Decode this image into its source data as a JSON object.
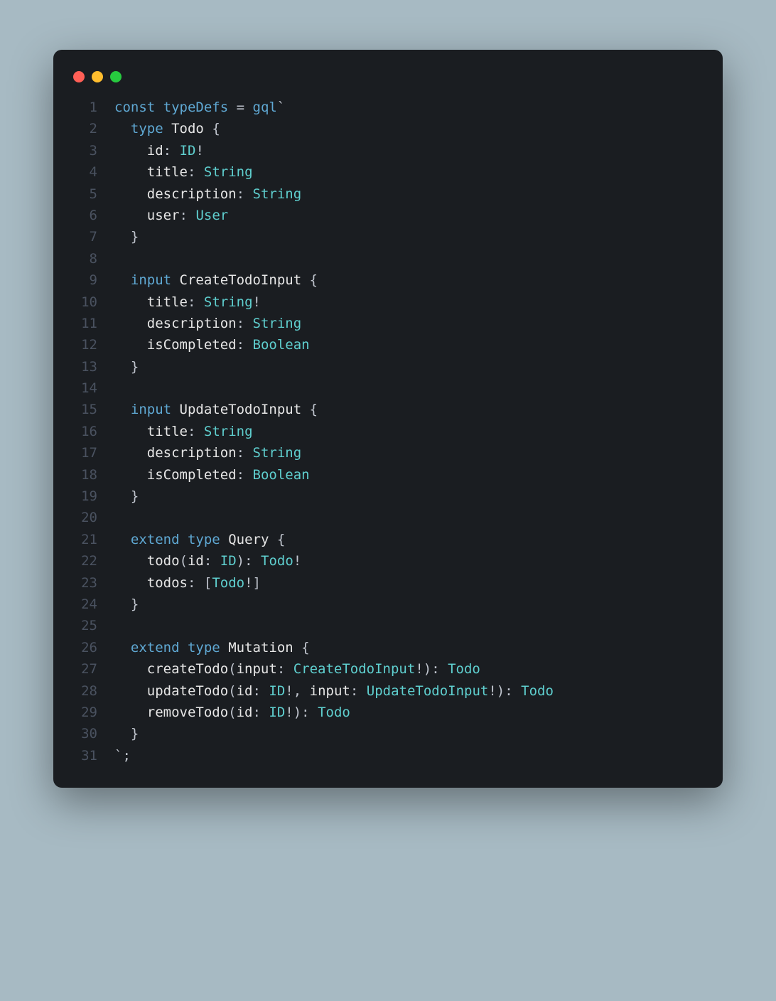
{
  "code": {
    "lines": [
      {
        "n": "1",
        "tokens": [
          [
            "kw",
            "const"
          ],
          [
            "plain",
            " "
          ],
          [
            "fn",
            "typeDefs"
          ],
          [
            "plain",
            " "
          ],
          [
            "op",
            "="
          ],
          [
            "plain",
            " "
          ],
          [
            "fn",
            "gql"
          ],
          [
            "punct",
            "`"
          ]
        ]
      },
      {
        "n": "2",
        "tokens": [
          [
            "plain",
            "  "
          ],
          [
            "kw",
            "type"
          ],
          [
            "plain",
            " "
          ],
          [
            "typename",
            "Todo"
          ],
          [
            "plain",
            " "
          ],
          [
            "punct",
            "{"
          ]
        ]
      },
      {
        "n": "3",
        "tokens": [
          [
            "plain",
            "    "
          ],
          [
            "field",
            "id"
          ],
          [
            "punct",
            ":"
          ],
          [
            "plain",
            " "
          ],
          [
            "ty",
            "ID"
          ],
          [
            "punct",
            "!"
          ]
        ]
      },
      {
        "n": "4",
        "tokens": [
          [
            "plain",
            "    "
          ],
          [
            "field",
            "title"
          ],
          [
            "punct",
            ":"
          ],
          [
            "plain",
            " "
          ],
          [
            "ty",
            "String"
          ]
        ]
      },
      {
        "n": "5",
        "tokens": [
          [
            "plain",
            "    "
          ],
          [
            "field",
            "description"
          ],
          [
            "punct",
            ":"
          ],
          [
            "plain",
            " "
          ],
          [
            "ty",
            "String"
          ]
        ]
      },
      {
        "n": "6",
        "tokens": [
          [
            "plain",
            "    "
          ],
          [
            "field",
            "user"
          ],
          [
            "punct",
            ":"
          ],
          [
            "plain",
            " "
          ],
          [
            "ty",
            "User"
          ]
        ]
      },
      {
        "n": "7",
        "tokens": [
          [
            "plain",
            "  "
          ],
          [
            "punct",
            "}"
          ]
        ]
      },
      {
        "n": "8",
        "tokens": [
          [
            "plain",
            ""
          ]
        ]
      },
      {
        "n": "9",
        "tokens": [
          [
            "plain",
            "  "
          ],
          [
            "kw",
            "input"
          ],
          [
            "plain",
            " "
          ],
          [
            "typename",
            "CreateTodoInput"
          ],
          [
            "plain",
            " "
          ],
          [
            "punct",
            "{"
          ]
        ]
      },
      {
        "n": "10",
        "tokens": [
          [
            "plain",
            "    "
          ],
          [
            "field",
            "title"
          ],
          [
            "punct",
            ":"
          ],
          [
            "plain",
            " "
          ],
          [
            "ty",
            "String"
          ],
          [
            "punct",
            "!"
          ]
        ]
      },
      {
        "n": "11",
        "tokens": [
          [
            "plain",
            "    "
          ],
          [
            "field",
            "description"
          ],
          [
            "punct",
            ":"
          ],
          [
            "plain",
            " "
          ],
          [
            "ty",
            "String"
          ]
        ]
      },
      {
        "n": "12",
        "tokens": [
          [
            "plain",
            "    "
          ],
          [
            "field",
            "isCompleted"
          ],
          [
            "punct",
            ":"
          ],
          [
            "plain",
            " "
          ],
          [
            "ty",
            "Boolean"
          ]
        ]
      },
      {
        "n": "13",
        "tokens": [
          [
            "plain",
            "  "
          ],
          [
            "punct",
            "}"
          ]
        ]
      },
      {
        "n": "14",
        "tokens": [
          [
            "plain",
            ""
          ]
        ]
      },
      {
        "n": "15",
        "tokens": [
          [
            "plain",
            "  "
          ],
          [
            "kw",
            "input"
          ],
          [
            "plain",
            " "
          ],
          [
            "typename",
            "UpdateTodoInput"
          ],
          [
            "plain",
            " "
          ],
          [
            "punct",
            "{"
          ]
        ]
      },
      {
        "n": "16",
        "tokens": [
          [
            "plain",
            "    "
          ],
          [
            "field",
            "title"
          ],
          [
            "punct",
            ":"
          ],
          [
            "plain",
            " "
          ],
          [
            "ty",
            "String"
          ]
        ]
      },
      {
        "n": "17",
        "tokens": [
          [
            "plain",
            "    "
          ],
          [
            "field",
            "description"
          ],
          [
            "punct",
            ":"
          ],
          [
            "plain",
            " "
          ],
          [
            "ty",
            "String"
          ]
        ]
      },
      {
        "n": "18",
        "tokens": [
          [
            "plain",
            "    "
          ],
          [
            "field",
            "isCompleted"
          ],
          [
            "punct",
            ":"
          ],
          [
            "plain",
            " "
          ],
          [
            "ty",
            "Boolean"
          ]
        ]
      },
      {
        "n": "19",
        "tokens": [
          [
            "plain",
            "  "
          ],
          [
            "punct",
            "}"
          ]
        ]
      },
      {
        "n": "20",
        "tokens": [
          [
            "plain",
            ""
          ]
        ]
      },
      {
        "n": "21",
        "tokens": [
          [
            "plain",
            "  "
          ],
          [
            "kw",
            "extend"
          ],
          [
            "plain",
            " "
          ],
          [
            "kw",
            "type"
          ],
          [
            "plain",
            " "
          ],
          [
            "typename",
            "Query"
          ],
          [
            "plain",
            " "
          ],
          [
            "punct",
            "{"
          ]
        ]
      },
      {
        "n": "22",
        "tokens": [
          [
            "plain",
            "    "
          ],
          [
            "field",
            "todo"
          ],
          [
            "punct",
            "("
          ],
          [
            "field",
            "id"
          ],
          [
            "punct",
            ":"
          ],
          [
            "plain",
            " "
          ],
          [
            "ty",
            "ID"
          ],
          [
            "punct",
            "):"
          ],
          [
            "plain",
            " "
          ],
          [
            "ty",
            "Todo"
          ],
          [
            "punct",
            "!"
          ]
        ]
      },
      {
        "n": "23",
        "tokens": [
          [
            "plain",
            "    "
          ],
          [
            "field",
            "todos"
          ],
          [
            "punct",
            ":"
          ],
          [
            "plain",
            " "
          ],
          [
            "punct",
            "["
          ],
          [
            "ty",
            "Todo"
          ],
          [
            "punct",
            "!]"
          ]
        ]
      },
      {
        "n": "24",
        "tokens": [
          [
            "plain",
            "  "
          ],
          [
            "punct",
            "}"
          ]
        ]
      },
      {
        "n": "25",
        "tokens": [
          [
            "plain",
            ""
          ]
        ]
      },
      {
        "n": "26",
        "tokens": [
          [
            "plain",
            "  "
          ],
          [
            "kw",
            "extend"
          ],
          [
            "plain",
            " "
          ],
          [
            "kw",
            "type"
          ],
          [
            "plain",
            " "
          ],
          [
            "typename",
            "Mutation"
          ],
          [
            "plain",
            " "
          ],
          [
            "punct",
            "{"
          ]
        ]
      },
      {
        "n": "27",
        "tokens": [
          [
            "plain",
            "    "
          ],
          [
            "field",
            "createTodo"
          ],
          [
            "punct",
            "("
          ],
          [
            "field",
            "input"
          ],
          [
            "punct",
            ":"
          ],
          [
            "plain",
            " "
          ],
          [
            "ty",
            "CreateTodoInput"
          ],
          [
            "punct",
            "!):"
          ],
          [
            "plain",
            " "
          ],
          [
            "ty",
            "Todo"
          ]
        ]
      },
      {
        "n": "28",
        "tokens": [
          [
            "plain",
            "    "
          ],
          [
            "field",
            "updateTodo"
          ],
          [
            "punct",
            "("
          ],
          [
            "field",
            "id"
          ],
          [
            "punct",
            ":"
          ],
          [
            "plain",
            " "
          ],
          [
            "ty",
            "ID"
          ],
          [
            "punct",
            "!,"
          ],
          [
            "plain",
            " "
          ],
          [
            "field",
            "input"
          ],
          [
            "punct",
            ":"
          ],
          [
            "plain",
            " "
          ],
          [
            "ty",
            "UpdateTodoInput"
          ],
          [
            "punct",
            "!):"
          ],
          [
            "plain",
            " "
          ],
          [
            "ty",
            "Todo"
          ]
        ]
      },
      {
        "n": "29",
        "tokens": [
          [
            "plain",
            "    "
          ],
          [
            "field",
            "removeTodo"
          ],
          [
            "punct",
            "("
          ],
          [
            "field",
            "id"
          ],
          [
            "punct",
            ":"
          ],
          [
            "plain",
            " "
          ],
          [
            "ty",
            "ID"
          ],
          [
            "punct",
            "!):"
          ],
          [
            "plain",
            " "
          ],
          [
            "ty",
            "Todo"
          ]
        ]
      },
      {
        "n": "30",
        "tokens": [
          [
            "plain",
            "  "
          ],
          [
            "punct",
            "}"
          ]
        ]
      },
      {
        "n": "31",
        "tokens": [
          [
            "punct",
            "`;"
          ]
        ]
      }
    ]
  }
}
